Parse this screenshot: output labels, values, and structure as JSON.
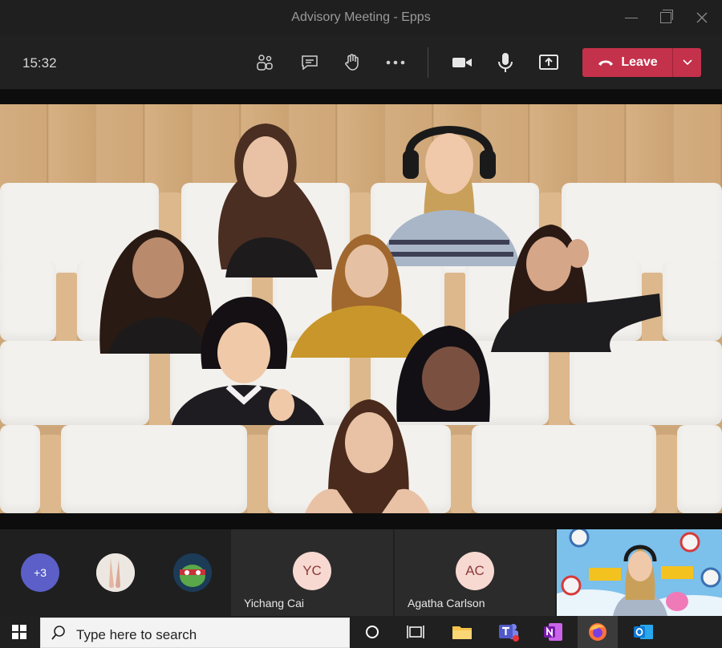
{
  "window": {
    "title": "Advisory Meeting - Epps"
  },
  "toolbar": {
    "clock": "15:32",
    "leave_label": "Leave",
    "icons": [
      "participants-icon",
      "chat-icon",
      "raise-hand-icon",
      "more-options-icon",
      "camera-icon",
      "microphone-icon",
      "share-screen-icon"
    ]
  },
  "participants": {
    "overflow_count": "+3",
    "tiles": [
      {
        "initials": "YC",
        "name": "Yichang Cai"
      },
      {
        "initials": "AC",
        "name": "Agatha Carlson"
      }
    ]
  },
  "taskbar": {
    "search_placeholder": "Type here to search"
  },
  "colors": {
    "leave_button": "#c4314b",
    "overflow_avatar": "#5b5fc7",
    "initials_avatar_bg": "#f7d9d2",
    "initials_avatar_text": "#8d3a3a"
  }
}
